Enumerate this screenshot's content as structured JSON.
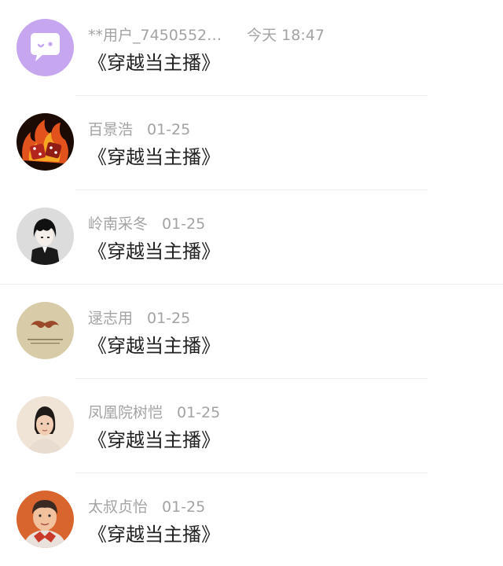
{
  "comments": [
    {
      "user": "**用户_7450552…",
      "time": "今天 18:47",
      "text": "《穿越当主播》",
      "avatar_icon": "chat-bubble-default-avatar",
      "avatar_color": "#c7a6f0"
    },
    {
      "user": "百景浩",
      "time": "01-25",
      "text": "《穿越当主播》",
      "avatar_icon": "flaming-dice-avatar",
      "avatar_color": "#d9411a"
    },
    {
      "user": "岭南采冬",
      "time": "01-25",
      "text": "《穿越当主播》",
      "avatar_icon": "anime-boy-avatar",
      "avatar_color": "#dcdcdc"
    },
    {
      "user": "逯志用",
      "time": "01-25",
      "text": "《穿越当主播》",
      "avatar_icon": "mustache-avatar",
      "avatar_color": "#d8cba7"
    },
    {
      "user": "凤凰院树恺",
      "time": "01-25",
      "text": "《穿越当主播》",
      "avatar_icon": "girl-photo-avatar",
      "avatar_color": "#efe4d6"
    },
    {
      "user": "太叔贞怡",
      "time": "01-25",
      "text": "《穿越当主播》",
      "avatar_icon": "child-photo-avatar",
      "avatar_color": "#d8642e"
    }
  ]
}
